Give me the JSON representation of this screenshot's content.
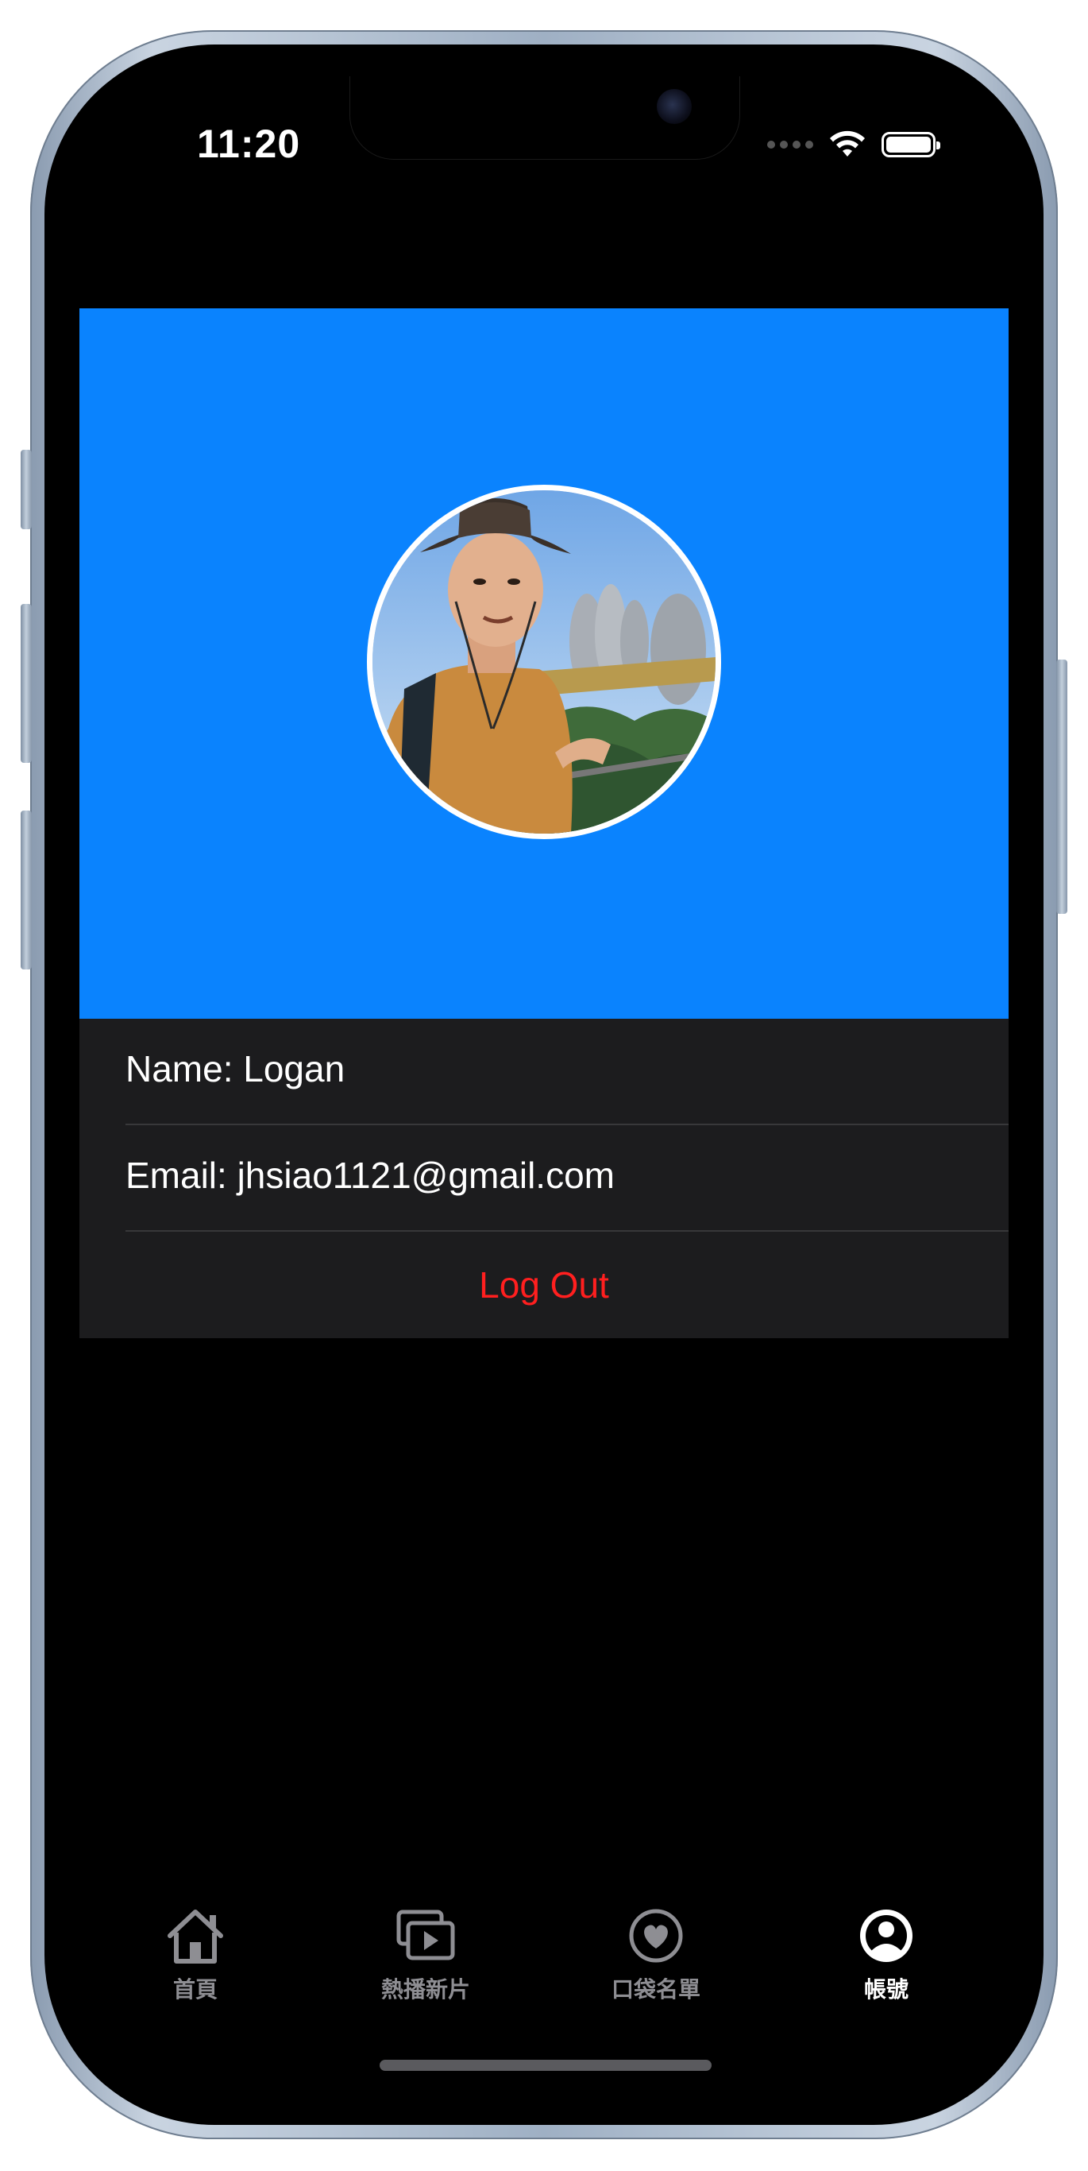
{
  "status_bar": {
    "time": "11:20"
  },
  "profile": {
    "header_color": "#0a83fe",
    "avatar_alt": "profile-photo"
  },
  "info": {
    "name_text": "Name: Logan",
    "email_text": "Email: jhsiao1121@gmail.com",
    "logout_label": "Log Out",
    "logout_color": "#ff1f1f"
  },
  "tabbar": {
    "items": [
      {
        "label": "首頁",
        "icon": "house-icon",
        "active": false
      },
      {
        "label": "熱播新片",
        "icon": "play-rectangle-stack-icon",
        "active": false
      },
      {
        "label": "口袋名單",
        "icon": "heart-circle-icon",
        "active": false
      },
      {
        "label": "帳號",
        "icon": "person-circle-icon",
        "active": true
      }
    ]
  }
}
